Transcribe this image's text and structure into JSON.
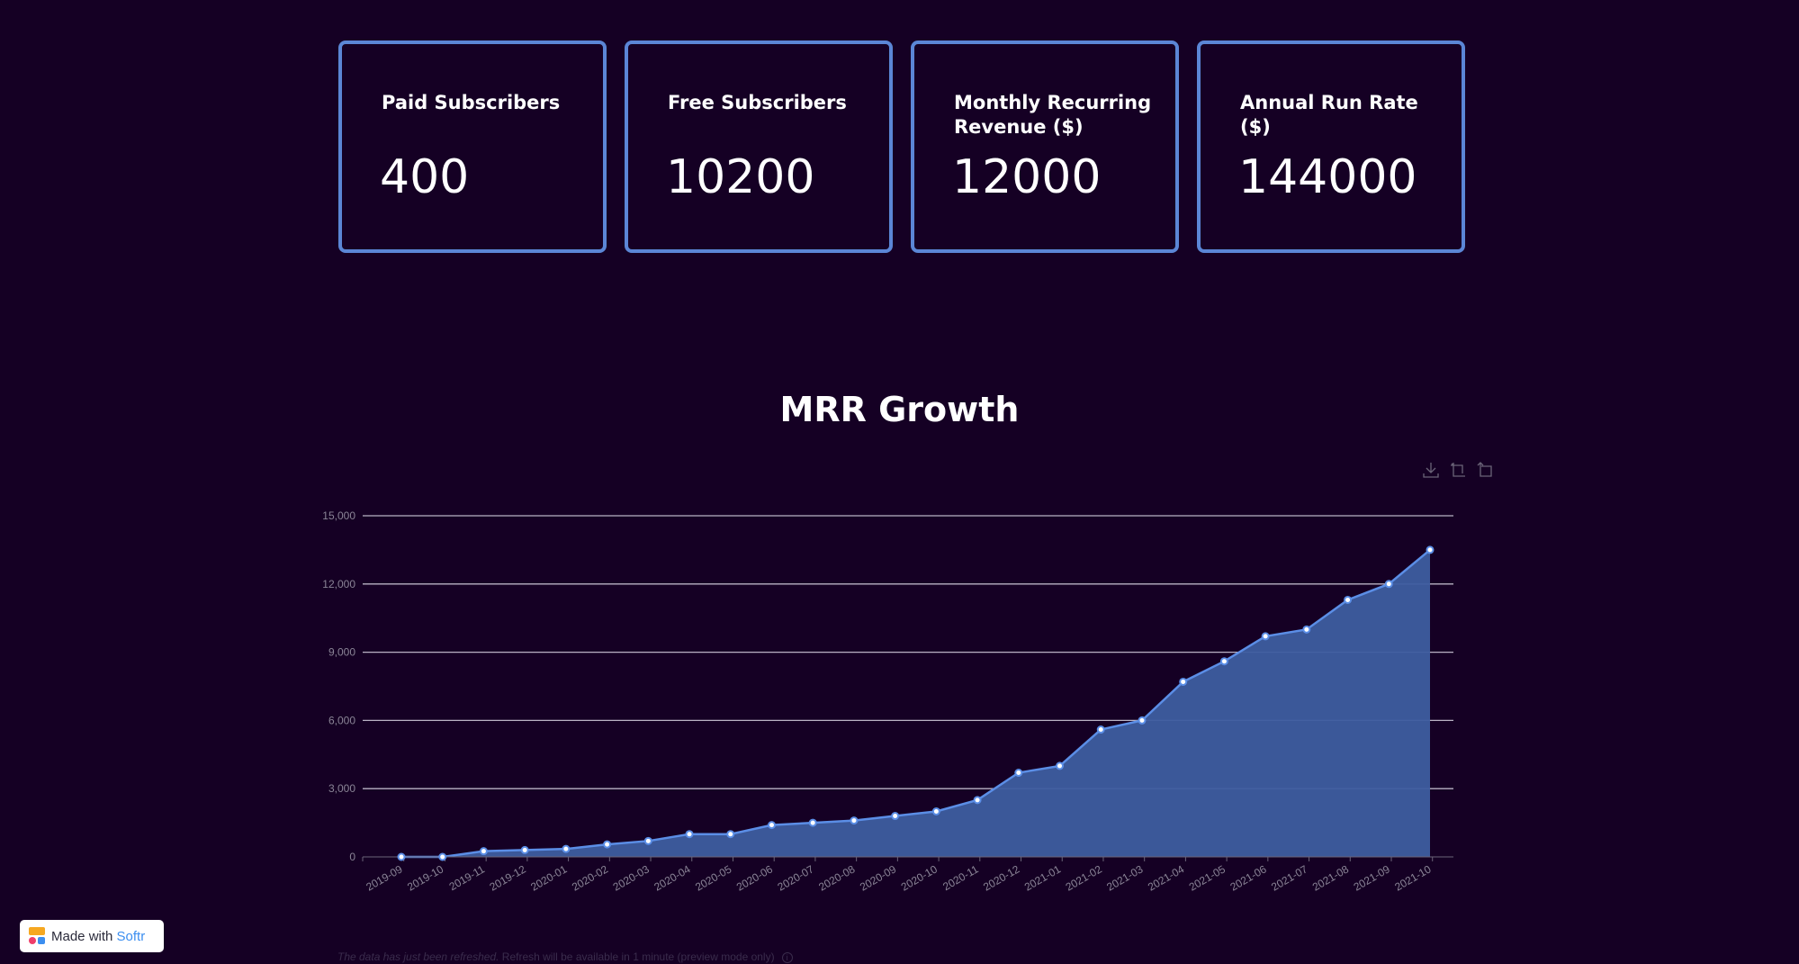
{
  "kpi_cards": [
    {
      "title": "Paid Subscribers",
      "value": "400"
    },
    {
      "title": "Free Subscribers",
      "value": "10200"
    },
    {
      "title": "Monthly Recurring Revenue ($)",
      "value": "12000"
    },
    {
      "title": "Annual Run Rate ($)",
      "value": "144000"
    }
  ],
  "toolbar": {
    "icons": [
      "download-icon",
      "crop-icon",
      "reset-icon"
    ]
  },
  "colors": {
    "background": "#150024",
    "card_border": "#5b86d6",
    "area_fill": "#3d5da0",
    "line": "#5b8ee6",
    "gridline": "#b9b3c4",
    "axis_text": "#8a8496"
  },
  "chart_data": {
    "type": "area",
    "title": "MRR Growth",
    "xlabel": "",
    "ylabel": "",
    "ylim": [
      0,
      15000
    ],
    "yticks": [
      0,
      3000,
      6000,
      9000,
      12000,
      15000
    ],
    "ytick_labels": [
      "0",
      "3,000",
      "6,000",
      "9,000",
      "12,000",
      "15,000"
    ],
    "grid": true,
    "legend": "none",
    "categories": [
      "2019-09",
      "2019-10",
      "2019-11",
      "2019-12",
      "2020-01",
      "2020-02",
      "2020-03",
      "2020-04",
      "2020-05",
      "2020-06",
      "2020-07",
      "2020-08",
      "2020-09",
      "2020-10",
      "2020-11",
      "2020-12",
      "2021-01",
      "2021-02",
      "2021-03",
      "2021-04",
      "2021-05",
      "2021-06",
      "2021-07",
      "2021-08",
      "2021-09",
      "2021-10"
    ],
    "series": [
      {
        "name": "MRR",
        "values": [
          0,
          0,
          250,
          300,
          350,
          550,
          700,
          1000,
          1000,
          1400,
          1500,
          1600,
          1800,
          2000,
          2500,
          3700,
          4000,
          5600,
          6000,
          7700,
          8600,
          9700,
          10000,
          11300,
          12000,
          13500
        ]
      }
    ]
  },
  "footer": {
    "badge_prefix": "Made with ",
    "badge_brand": "Softr",
    "note_italic": "The data has just been refreshed.",
    "note_rest": " Refresh will be available in 1 minute (preview mode only)",
    "info_glyph": "i"
  }
}
